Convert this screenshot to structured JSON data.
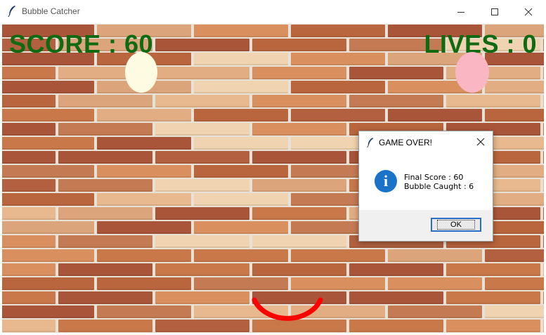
{
  "window": {
    "title": "Bubble Catcher"
  },
  "hud": {
    "score_text": "SCORE : 60",
    "lives_text": "LIVES : 0"
  },
  "dialog": {
    "title": "GAME OVER!",
    "line1": "Final Score : 60",
    "line2": "Bubble Caught : 6",
    "ok_label": "OK"
  },
  "colors": {
    "hud_text": "#0f6a12",
    "bubble_cream": "#fdfbe1",
    "bubble_pink": "#fbb6c4",
    "catcher": "#ff0000",
    "info_icon": "#1a73c8"
  },
  "icons": {
    "app": "feather-icon",
    "minimize": "minimize-icon",
    "maximize": "maximize-icon",
    "close": "close-icon",
    "info": "info-icon"
  }
}
